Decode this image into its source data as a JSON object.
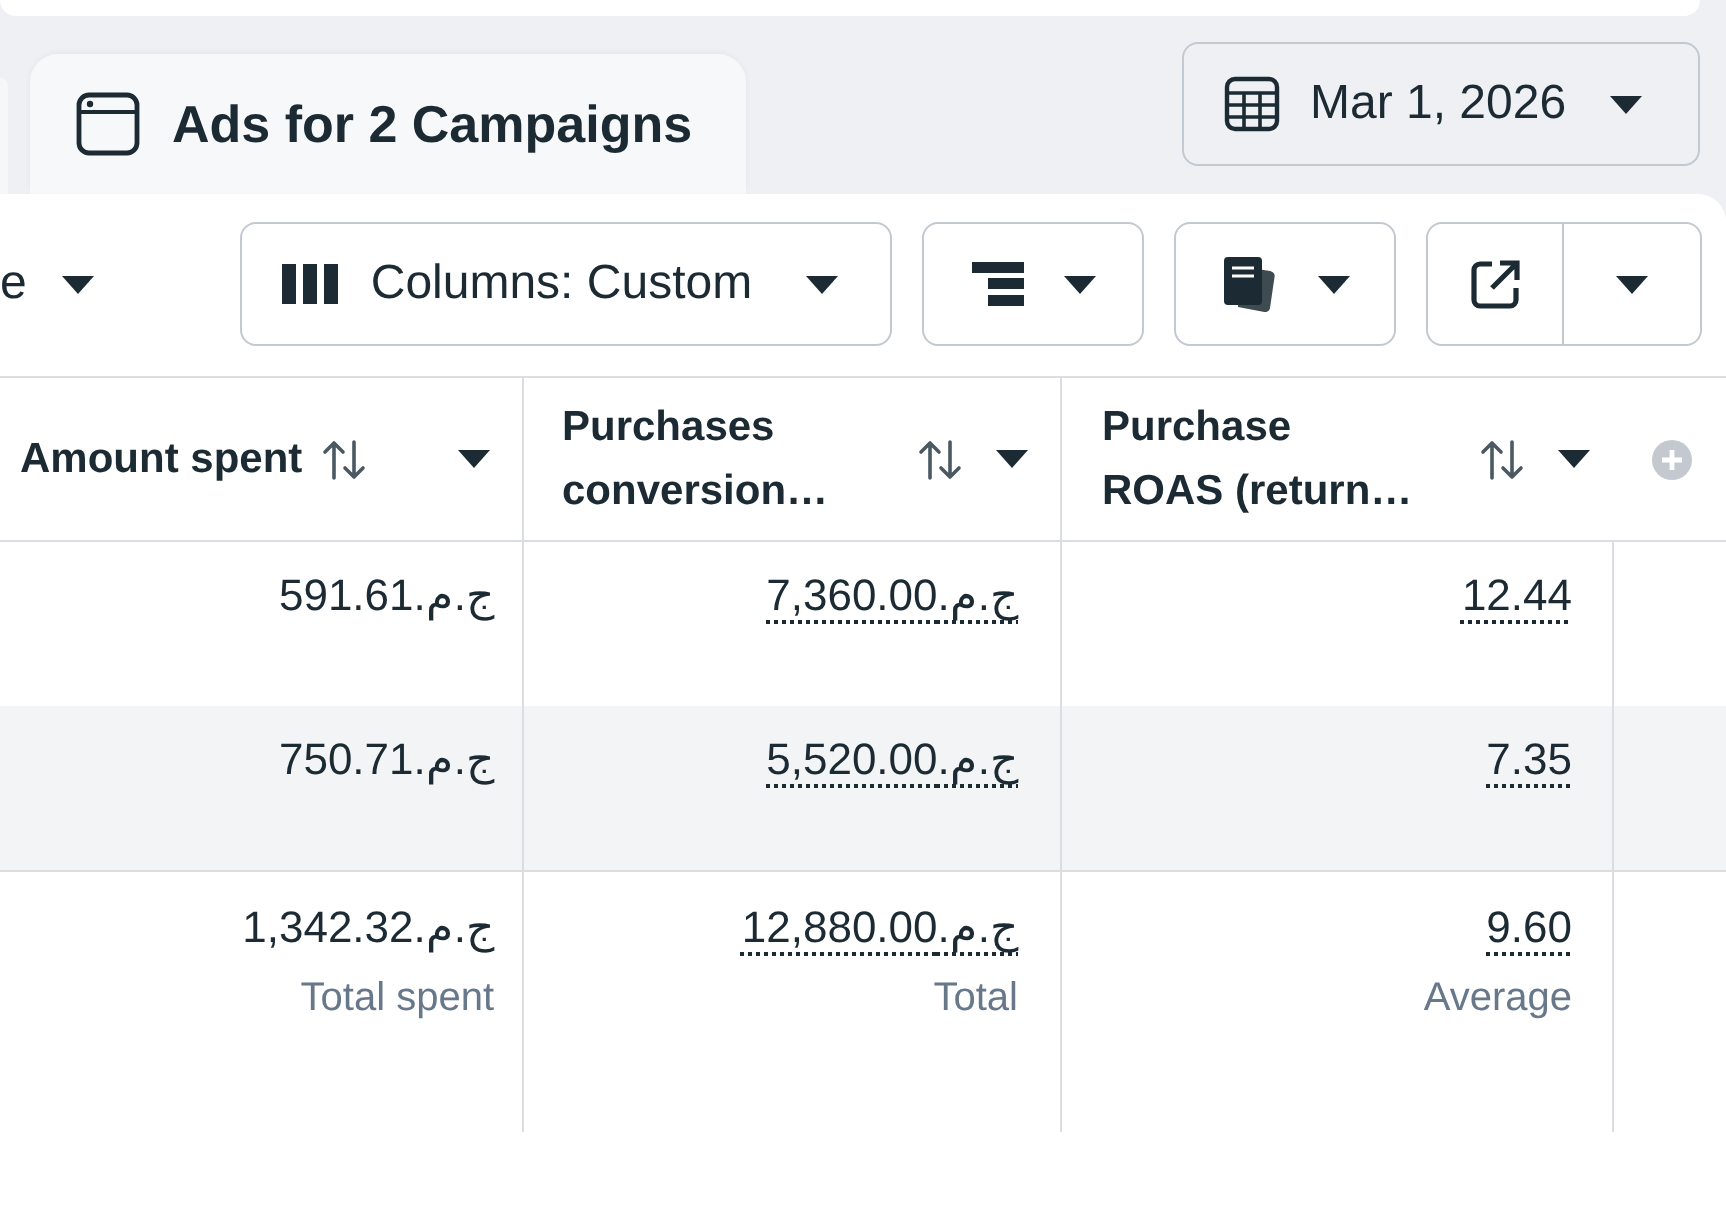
{
  "tabs": [
    {
      "label": "Ads for 2 Campaigns",
      "selected": true
    }
  ],
  "date_picker": {
    "value": "Mar 1, 2026"
  },
  "toolbar": {
    "view_dropdown": {
      "label": "e"
    },
    "columns_button": {
      "label": "Columns: Custom"
    }
  },
  "table": {
    "columns": [
      {
        "label": "Amount spent"
      },
      {
        "label": "Purchases conversion…"
      },
      {
        "label": "Purchase ROAS (return…"
      }
    ],
    "rows": [
      {
        "kind": "data",
        "hovered": false,
        "cells": [
          {
            "value": "ج.م.591.61",
            "dotted": false
          },
          {
            "value": "ج.م.7,360.00",
            "dotted": true
          },
          {
            "value": "12.44",
            "dotted": true
          }
        ]
      },
      {
        "kind": "data",
        "hovered": true,
        "cells": [
          {
            "value": "ج.م.750.71",
            "dotted": false
          },
          {
            "value": "ج.م.5,520.00",
            "dotted": true
          },
          {
            "value": "7.35",
            "dotted": true
          }
        ]
      },
      {
        "kind": "total",
        "hovered": false,
        "cells": [
          {
            "value": "ج.م.1,342.32",
            "dotted": false,
            "caption": "Total spent"
          },
          {
            "value": "ج.م.12,880.00",
            "dotted": true,
            "caption": "Total"
          },
          {
            "value": "9.60",
            "dotted": true,
            "caption": "Average"
          }
        ]
      }
    ]
  }
}
